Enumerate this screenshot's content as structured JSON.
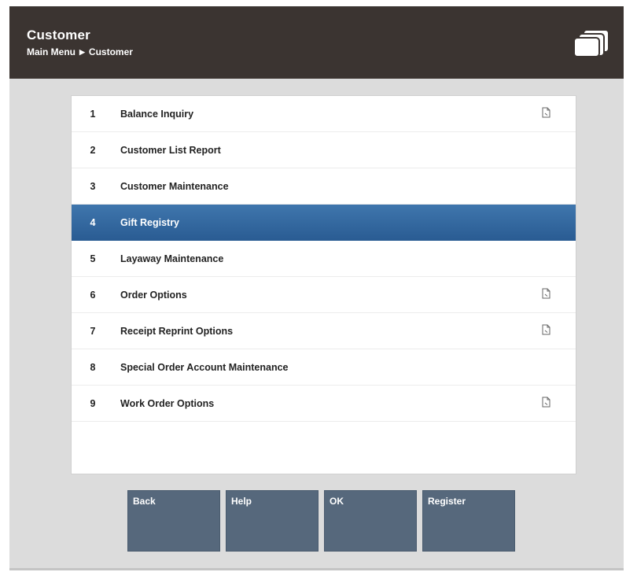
{
  "header": {
    "title": "Customer",
    "breadcrumb": [
      "Main Menu",
      "Customer"
    ],
    "breadcrumb_separator": "▶",
    "icon": "window-stack-icon"
  },
  "menu": {
    "selected_index": 3,
    "items": [
      {
        "num": "1",
        "label": "Balance Inquiry",
        "has_submenu": true
      },
      {
        "num": "2",
        "label": "Customer List Report",
        "has_submenu": false
      },
      {
        "num": "3",
        "label": "Customer Maintenance",
        "has_submenu": false
      },
      {
        "num": "4",
        "label": "Gift Registry",
        "has_submenu": false
      },
      {
        "num": "5",
        "label": "Layaway Maintenance",
        "has_submenu": false
      },
      {
        "num": "6",
        "label": "Order Options",
        "has_submenu": true
      },
      {
        "num": "7",
        "label": "Receipt Reprint Options",
        "has_submenu": true
      },
      {
        "num": "8",
        "label": "Special Order Account Maintenance",
        "has_submenu": false
      },
      {
        "num": "9",
        "label": "Work Order Options",
        "has_submenu": true
      }
    ]
  },
  "buttons": {
    "back": "Back",
    "help": "Help",
    "ok": "OK",
    "register": "Register"
  },
  "colors": {
    "header_bg": "#3b3431",
    "selected_row": "#2f669e",
    "button_bg": "#56687c",
    "page_bg": "#dcdcdc"
  }
}
